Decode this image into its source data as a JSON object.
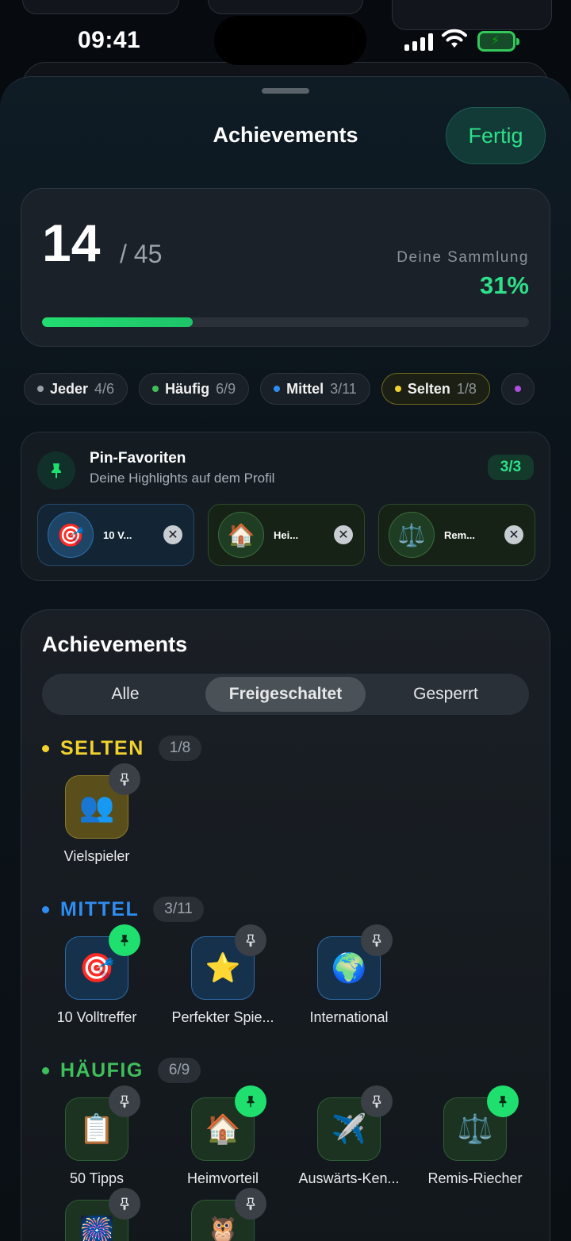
{
  "status_bar": {
    "time": "09:41"
  },
  "sheet": {
    "title": "Achievements",
    "done_label": "Fertig"
  },
  "summary": {
    "unlocked": "14",
    "total": "/ 45",
    "collection_label": "Deine Sammlung",
    "percent_label": "31%",
    "progress_fraction": 0.31
  },
  "rarity_chips": [
    {
      "label": "Jeder",
      "count": "4/6",
      "color": "#9aa0a6"
    },
    {
      "label": "Häufig",
      "count": "6/9",
      "color": "#3fbf5a"
    },
    {
      "label": "Mittel",
      "count": "3/11",
      "color": "#2f8cf0"
    },
    {
      "label": "Selten",
      "count": "1/8",
      "color": "#f2d22e"
    }
  ],
  "pins": {
    "title": "Pin-Favoriten",
    "subtitle": "Deine Highlights auf dem Profil",
    "badge": "3/3",
    "slots": [
      {
        "name": "10 V...",
        "icon": "dart-target-icon"
      },
      {
        "name": "Hei...",
        "icon": "house-icon"
      },
      {
        "name": "Rem...",
        "icon": "scales-icon"
      }
    ]
  },
  "achievements": {
    "title": "Achievements",
    "segments": [
      "Alle",
      "Freigeschaltet",
      "Gesperrt"
    ],
    "selected_segment": "Freigeschaltet",
    "groups": [
      {
        "name": "SELTEN",
        "count": "1/8",
        "color": "#f2d22e",
        "items": [
          {
            "name": "Vielspieler",
            "icon": "people-icon",
            "pinned": false
          }
        ]
      },
      {
        "name": "MITTEL",
        "count": "3/11",
        "color": "#2f8cf0",
        "items": [
          {
            "name": "10 Volltreffer",
            "icon": "dart-target-icon",
            "pinned": true
          },
          {
            "name": "Perfekter Spie...",
            "icon": "star-icon",
            "pinned": false
          },
          {
            "name": "International",
            "icon": "globe-icon",
            "pinned": false
          }
        ]
      },
      {
        "name": "HÄUFIG",
        "count": "6/9",
        "color": "#3fbf5a",
        "items": [
          {
            "name": "50 Tipps",
            "icon": "clipboard-icon",
            "pinned": false
          },
          {
            "name": "Heimvorteil",
            "icon": "house-icon",
            "pinned": true
          },
          {
            "name": "Auswärts-Ken...",
            "icon": "airplane-icon",
            "pinned": false
          },
          {
            "name": "Remis-Riecher",
            "icon": "scales-icon",
            "pinned": true
          },
          {
            "name": "",
            "icon": "fireworks-icon",
            "pinned": false
          },
          {
            "name": "",
            "icon": "owl-icon",
            "pinned": false
          }
        ]
      }
    ]
  }
}
